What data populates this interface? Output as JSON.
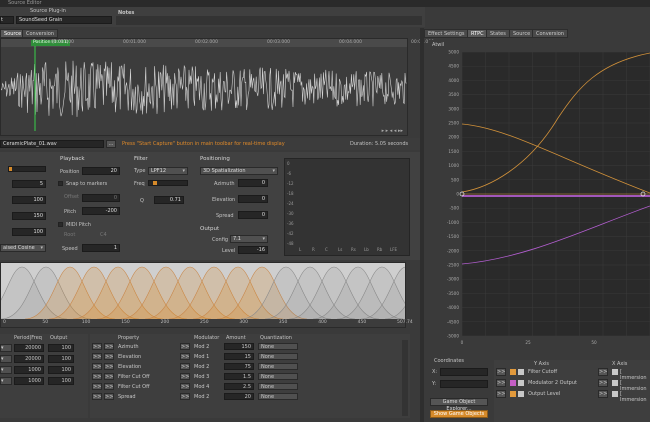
{
  "top": {
    "title": "Source Editor",
    "left_field": "t",
    "source_plugin_label": "Source Plug-in",
    "source_plugin_value": "SoundSeed Grain",
    "notes_label": "Notes"
  },
  "left_tabs": [
    "Source",
    "Conversion"
  ],
  "waveform": {
    "position_label": "Position (1.011)",
    "ticks": [
      "00:00.000",
      "00:01.000",
      "00:02.000",
      "00:03.000",
      "00:04.000",
      "00:05.000"
    ],
    "filename": "CeramicPlate_01.wav",
    "capture_hint": "Press \"Start Capture\" button in main toolbar for real-time display",
    "duration": "Duration: 5.05 seconds"
  },
  "controls": {
    "col1_values": [
      "5",
      "100",
      "150",
      "100"
    ],
    "window_select": "aised Cosine",
    "playback": {
      "title": "Playback",
      "position_label": "Position",
      "position_value": "20",
      "snap_label": "Snap to markers",
      "offset_label": "Offset",
      "offset_value": "0",
      "pitch_label": "Pitch",
      "pitch_value": "-200",
      "midi_label": "MIDI Pitch",
      "root_label": "Root",
      "root_value": "C4",
      "speed_label": "Speed",
      "speed_value": "1"
    },
    "filter": {
      "title": "Filter",
      "type_label": "Type",
      "type_value": "LPF12",
      "freq_label": "Freq",
      "q_label": "Q",
      "q_value": "0.71"
    },
    "positioning": {
      "title": "Positioning",
      "mode_value": "3D Spatialization",
      "azimuth_label": "Azimuth",
      "azimuth_value": "0",
      "elevation_label": "Elevation",
      "elevation_value": "0",
      "spread_label": "Spread",
      "spread_value": "0"
    },
    "output": {
      "title": "Output",
      "config_label": "Config",
      "config_value": "7.1",
      "level_label": "Level",
      "level_value": "-16"
    }
  },
  "meter": {
    "db_labels": [
      "0",
      "-6",
      "-12",
      "-18",
      "-24",
      "-30",
      "-36",
      "-42",
      "-48"
    ],
    "freq_labels": [
      "L",
      "R",
      "C",
      "Ls",
      "Rs",
      "Lb",
      "Rb",
      "LFE"
    ]
  },
  "grain_view": {
    "ticks": [
      "0",
      "50",
      "100",
      "150",
      "200",
      "250",
      "300",
      "350",
      "400",
      "450",
      "507.74"
    ]
  },
  "mod_table": {
    "headers": [
      "Period|Freq",
      "Output"
    ],
    "rows": [
      {
        "a": "20000",
        "b": "100"
      },
      {
        "a": "20000",
        "b": "100"
      },
      {
        "a": "1000",
        "b": "100"
      },
      {
        "a": "1000",
        "b": "100"
      }
    ]
  },
  "prop_table": {
    "headers": [
      "Property",
      "Modulator",
      "Amount",
      "Quantization"
    ],
    "rows": [
      {
        "prop": "Azimuth",
        "mod": "Mod 2",
        "amount": "150",
        "quant": "None"
      },
      {
        "prop": "Elevation",
        "mod": "Mod 1",
        "amount": "15",
        "quant": "None"
      },
      {
        "prop": "Elevation",
        "mod": "Mod 2",
        "amount": "75",
        "quant": "None"
      },
      {
        "prop": "Filter Cut Off",
        "mod": "Mod 3",
        "amount": "1.5",
        "quant": "None"
      },
      {
        "prop": "Filter Cut Off",
        "mod": "Mod 4",
        "amount": "2.5",
        "quant": "None"
      },
      {
        "prop": "Spread",
        "mod": "Mod 2",
        "amount": "20",
        "quant": "None"
      }
    ],
    "btn_label": ">>"
  },
  "right": {
    "tabs": [
      "Effect Settings",
      "RTPC",
      "States",
      "Source",
      "Conversion"
    ],
    "active_tab": "RTPC",
    "graph_title": "Atwil",
    "y_ticks": [
      "5000",
      "4500",
      "4000",
      "3500",
      "3000",
      "2500",
      "2000",
      "1500",
      "1000",
      "500",
      "0",
      "-500",
      "-1000",
      "-1500",
      "-2000",
      "-2500",
      "-3000",
      "-3500",
      "-4000",
      "-4500",
      "-5000"
    ],
    "x_ticks": [
      "0",
      "25",
      "50"
    ],
    "coords_title": "Coordinates",
    "x_label": "X:",
    "y_label": "Y:",
    "explorer_btn": "Game Object Explorer...",
    "show_btn": "Show Game Objects",
    "yaxis_header": "Y Axis",
    "xaxis_header": "X Axis",
    "rtpc_rows": [
      {
        "name": "Filter Cutoff",
        "x": "[ Immersion",
        "color": "#e29a3c"
      },
      {
        "name": "Modulator 2 Output",
        "x": "[ Immersion",
        "color": "#c45ec4"
      },
      {
        "name": "Output Level",
        "x": "[ Immersion",
        "color": "#e29a3c"
      }
    ]
  },
  "colors": {
    "accent": "#d68a2a",
    "curve_orange": "#d1913a",
    "curve_purple": "#b45ed1",
    "playhead": "#38d14a"
  }
}
